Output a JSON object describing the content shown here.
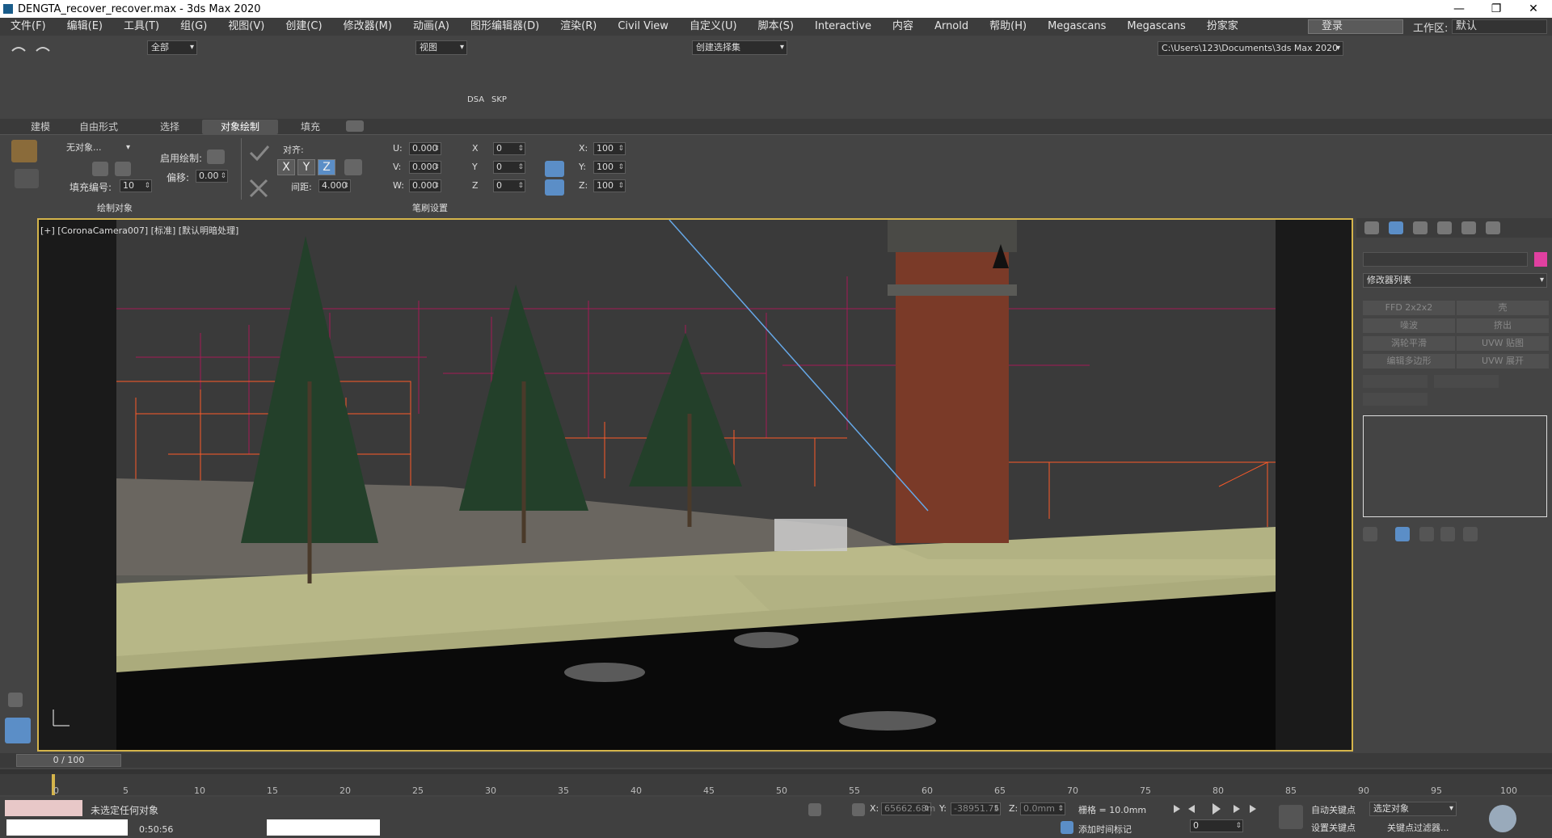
{
  "window": {
    "title": "DENGTA_recover_recover.max - 3ds Max 2020"
  },
  "menu": [
    "文件(F)",
    "编辑(E)",
    "工具(T)",
    "组(G)",
    "视图(V)",
    "创建(C)",
    "修改器(M)",
    "动画(A)",
    "图形编辑器(D)",
    "渲染(R)",
    "Civil View",
    "自定义(U)",
    "脚本(S)",
    "Interactive",
    "内容",
    "Arnold",
    "帮助(H)",
    "Megascans",
    "Megascans",
    "扮家家"
  ],
  "login": {
    "label": "登录"
  },
  "workspace": {
    "label": "工作区:",
    "value": "默认"
  },
  "toolbar": {
    "filter": "全部",
    "refcoord": "视图",
    "selset": "创建选择集",
    "path": "C:\\Users\\123\\Documents\\3ds Max 2020"
  },
  "toolbar3": {
    "dsa": "DSA",
    "skp": "SKP"
  },
  "ribbon_tabs": [
    "建模",
    "自由形式",
    "选择",
    "对象绘制",
    "填充"
  ],
  "ribbon": {
    "obj_dd": "无对象...",
    "enable_paint": "启用绘制:",
    "offset_label": "偏移:",
    "offset_value": "0.00",
    "fill_label": "填充编号:",
    "fill_value": "10",
    "align": "对齐:",
    "spacing_label": "间距:",
    "spacing_value": "4.000",
    "u": "U:",
    "v": "V:",
    "w": "W:",
    "u_val": "0.000",
    "v_val": "0.000",
    "w_val": "0.000",
    "x": "X",
    "y": "Y",
    "z": "Z",
    "x2": "0",
    "y2": "0",
    "z2": "0",
    "sx": "X:",
    "sy": "Y:",
    "sz": "Z:",
    "sx_val": "100",
    "sy_val": "100",
    "sz_val": "100",
    "group1": "绘制对象",
    "group2": "笔刷设置"
  },
  "viewport": {
    "label": "[+] [CoronaCamera007] [标准] [默认明暗处理]"
  },
  "cmd": {
    "mod_list": "修改器列表",
    "buttons": [
      "FFD 2x2x2",
      "壳",
      "噪波",
      "挤出",
      "涡轮平滑",
      "UVW 贴图",
      "编辑多边形",
      "UVW 展开"
    ]
  },
  "timeline": {
    "frame": "0 / 100",
    "ticks": [
      "0",
      "5",
      "10",
      "15",
      "20",
      "25",
      "30",
      "35",
      "40",
      "45",
      "50",
      "55",
      "60",
      "65",
      "70",
      "75",
      "80",
      "85",
      "90",
      "95",
      "100"
    ]
  },
  "status": {
    "selection": "未选定任何对象",
    "time": "0:50:56",
    "x_label": "X:",
    "x_val": "65662.68m",
    "y_label": "Y:",
    "y_val": "-38951.75",
    "z_label": "Z:",
    "z_val": "0.0mm",
    "grid": "栅格 = 10.0mm",
    "add_tag": "添加时间标记",
    "autokey": "自动关键点",
    "setkey": "设置关键点",
    "selected": "选定对象",
    "keyfilter": "关键点过滤器...",
    "spin_frame": "0"
  },
  "colors": {
    "accent": "#5b8ec7",
    "viewport_border": "#d4b44b",
    "swatch": "#e040a0"
  }
}
